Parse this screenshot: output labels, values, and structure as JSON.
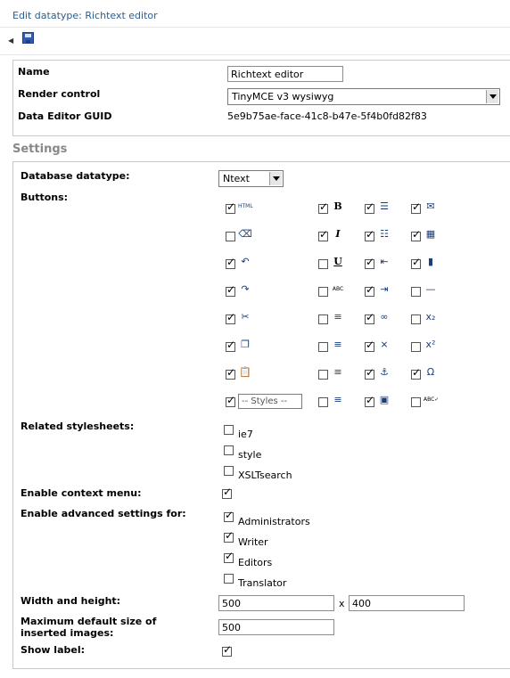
{
  "header": {
    "title": "Edit datatype: Richtext editor"
  },
  "toolbar": {
    "save_icon": "save-icon"
  },
  "general": {
    "name_label": "Name",
    "name_value": "Richtext editor",
    "render_label": "Render control",
    "render_value": "TinyMCE v3 wysiwyg",
    "guid_label": "Data Editor GUID",
    "guid_value": "5e9b75ae-face-41c8-b47e-5f4b0fd82f83"
  },
  "settings": {
    "heading": "Settings",
    "db_label": "Database datatype:",
    "db_value": "Ntext",
    "buttons_label": "Buttons:",
    "styles_dropdown": "-- Styles --",
    "stylesheets_label": "Related stylesheets:",
    "stylesheets": [
      {
        "label": "ie7",
        "checked": false
      },
      {
        "label": "style",
        "checked": false
      },
      {
        "label": "XSLTsearch",
        "checked": false
      }
    ],
    "context_label": "Enable context menu:",
    "context_checked": true,
    "advanced_label": "Enable advanced settings for:",
    "advanced": [
      {
        "label": "Administrators",
        "checked": true
      },
      {
        "label": "Writer",
        "checked": true
      },
      {
        "label": "Editors",
        "checked": true
      },
      {
        "label": "Translator",
        "checked": false
      }
    ],
    "wh_label": "Width and height:",
    "width": "500",
    "x_sep": "x",
    "height": "400",
    "maxsize_label": "Maximum default size of inserted images:",
    "maxsize": "500",
    "showlabel_label": "Show label:",
    "showlabel_checked": true
  },
  "buttons": [
    [
      {
        "icon": "html-icon",
        "glyph": "HTML",
        "on": true
      },
      {
        "icon": "bold-icon",
        "glyph": "B",
        "on": true
      },
      {
        "icon": "bullet-list-icon",
        "glyph": "☰",
        "on": true
      },
      {
        "icon": "image-icon",
        "glyph": "✉",
        "on": true
      }
    ],
    [
      {
        "icon": "eraser-icon",
        "glyph": "⌫",
        "on": false
      },
      {
        "icon": "italic-icon",
        "glyph": "I",
        "on": true
      },
      {
        "icon": "numbered-list-icon",
        "glyph": "☷",
        "on": true
      },
      {
        "icon": "table-icon",
        "glyph": "▦",
        "on": true
      }
    ],
    [
      {
        "icon": "undo-icon",
        "glyph": "↶",
        "on": true
      },
      {
        "icon": "underline-icon",
        "glyph": "U",
        "on": false
      },
      {
        "icon": "outdent-icon",
        "glyph": "⇤",
        "on": true
      },
      {
        "icon": "media-icon",
        "glyph": "▮",
        "on": true
      }
    ],
    [
      {
        "icon": "redo-icon",
        "glyph": "↷",
        "on": true
      },
      {
        "icon": "strikethrough-icon",
        "glyph": "ABC",
        "on": false
      },
      {
        "icon": "indent-icon",
        "glyph": "⇥",
        "on": true
      },
      {
        "icon": "horizontal-rule-icon",
        "glyph": "—",
        "on": false
      }
    ],
    [
      {
        "icon": "cut-icon",
        "glyph": "✂",
        "on": true
      },
      {
        "icon": "align-left-icon",
        "glyph": "≡",
        "on": false
      },
      {
        "icon": "link-icon",
        "glyph": "∞",
        "on": true
      },
      {
        "icon": "subscript-icon",
        "glyph": "x₂",
        "on": false
      }
    ],
    [
      {
        "icon": "copy-icon",
        "glyph": "❐",
        "on": true
      },
      {
        "icon": "align-center-icon",
        "glyph": "≡",
        "on": false
      },
      {
        "icon": "unlink-icon",
        "glyph": "⨯",
        "on": true
      },
      {
        "icon": "superscript-icon",
        "glyph": "x²",
        "on": false
      }
    ],
    [
      {
        "icon": "paste-icon",
        "glyph": "📋",
        "on": true
      },
      {
        "icon": "align-right-icon",
        "glyph": "≡",
        "on": false
      },
      {
        "icon": "anchor-icon",
        "glyph": "⚓",
        "on": true
      },
      {
        "icon": "special-char-icon",
        "glyph": "Ω",
        "on": true
      }
    ],
    [
      {
        "icon": "styles-dropdown-icon",
        "glyph": "",
        "on": true
      },
      {
        "icon": "justify-icon",
        "glyph": "≡",
        "on": false
      },
      {
        "icon": "macro-icon",
        "glyph": "▣",
        "on": true
      },
      {
        "icon": "spellcheck-icon",
        "glyph": "ABC✓",
        "on": false
      }
    ]
  ]
}
